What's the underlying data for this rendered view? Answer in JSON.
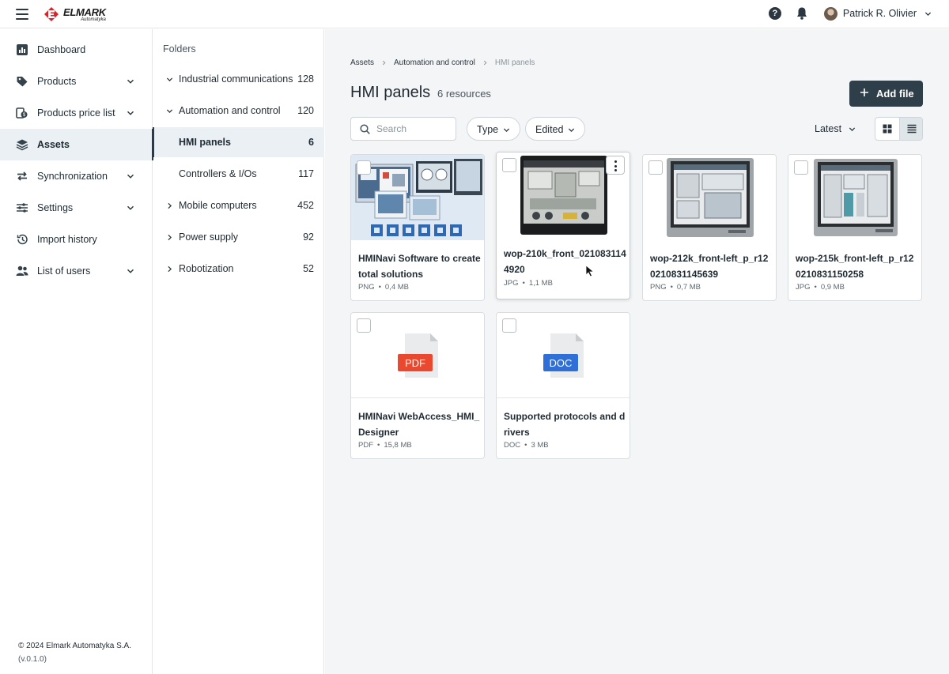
{
  "header": {
    "logo_brand": "ELMARK",
    "logo_sub": "Automatyka",
    "help_symbol": "?",
    "user_name": "Patrick R. Olivier"
  },
  "sidebar": {
    "items": [
      {
        "label": "Dashboard",
        "icon": "chart-icon"
      },
      {
        "label": "Products",
        "icon": "tag-icon"
      },
      {
        "label": "Products price list",
        "icon": "price-list-icon"
      },
      {
        "label": "Assets",
        "icon": "layers-icon"
      },
      {
        "label": "Synchronization",
        "icon": "sync-icon"
      },
      {
        "label": "Settings",
        "icon": "sliders-icon"
      },
      {
        "label": "Import history",
        "icon": "history-icon"
      },
      {
        "label": "List of users",
        "icon": "users-icon"
      }
    ],
    "footer_copyright": "© 2024 Elmark Automatyka S.A.",
    "footer_version": "(v.0.1.0)"
  },
  "folders": {
    "title": "Folders",
    "items": [
      {
        "name": "Industrial communications",
        "count": "128"
      },
      {
        "name": "Automation and control",
        "count": "120"
      },
      {
        "name": "HMI panels",
        "count": "6"
      },
      {
        "name": "Controllers & I/Os",
        "count": "117"
      },
      {
        "name": "Mobile computers",
        "count": "452"
      },
      {
        "name": "Power supply",
        "count": "92"
      },
      {
        "name": "Robotization",
        "count": "52"
      }
    ]
  },
  "main": {
    "breadcrumb": [
      "Assets",
      "Automation and control",
      "HMI panels"
    ],
    "title": "HMI panels",
    "count": "6 resources",
    "add_button": "Add file",
    "search_placeholder": "Search",
    "filter_type": "Type",
    "filter_edited": "Edited",
    "sort": "Latest",
    "cards": [
      {
        "title": "HMINavi Software to create total solutions",
        "type": "PNG",
        "size": "0,4 MB"
      },
      {
        "title": "wop-210k_front_0210831144920",
        "type": "JPG",
        "size": "1,1 MB"
      },
      {
        "title": "wop-212k_front-left_p_r120210831145639",
        "type": "PNG",
        "size": "0,7 MB"
      },
      {
        "title": "wop-215k_front-left_p_r120210831150258",
        "type": "JPG",
        "size": "0,9 MB"
      },
      {
        "title": "HMINavi WebAccess_HMI_Designer",
        "type": "PDF",
        "size": "15,8 MB",
        "badge": "PDF"
      },
      {
        "title": "Supported protocols and drivers",
        "type": "DOC",
        "size": "3 MB",
        "badge": "DOC"
      }
    ]
  },
  "colors": {
    "primary_button": "#2f3f49",
    "active_bg": "#eaf0f3",
    "pdf_badge": "#e8492f",
    "doc_badge": "#2f6fd6",
    "main_bg": "#f4f5f6"
  }
}
